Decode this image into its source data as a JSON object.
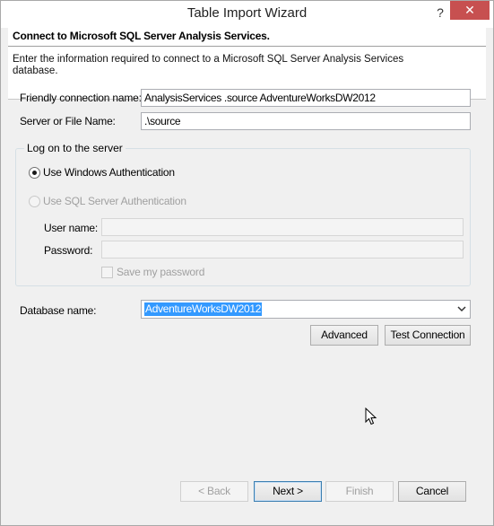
{
  "window": {
    "title": "Table Import Wizard",
    "help_glyph": "?",
    "close_glyph": "✕"
  },
  "header": {
    "title": "Connect to Microsoft SQL Server Analysis Services.",
    "description": "Enter the information required to connect to a Microsoft SQL Server Analysis Services database."
  },
  "form": {
    "friendly_label": "Friendly connection name:",
    "friendly_value": "AnalysisServices .source AdventureWorksDW2012",
    "server_label": "Server or File Name:",
    "server_value": ".\\source",
    "logon_group": "Log on to the server",
    "windows_auth_label": "Use Windows Authentication",
    "sql_auth_label": "Use SQL Server Authentication",
    "username_label": "User name:",
    "username_value": "",
    "password_label": "Password:",
    "password_value": "",
    "save_password_label": "Save my password",
    "database_label": "Database name:",
    "database_value": "AdventureWorksDW2012"
  },
  "buttons": {
    "advanced": "Advanced",
    "test_connection": "Test Connection",
    "back": "< Back",
    "next": "Next >",
    "finish": "Finish",
    "cancel": "Cancel"
  },
  "colors": {
    "selection": "#3399ff",
    "close_button": "#c75050",
    "dialog_bg": "#f0f0f0"
  }
}
